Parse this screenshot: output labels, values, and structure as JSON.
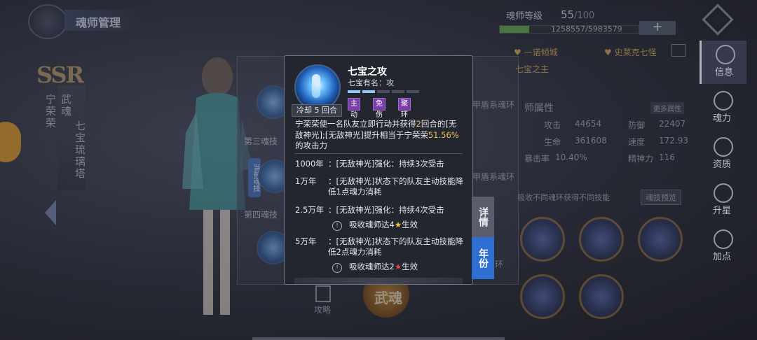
{
  "header": {
    "title": "魂师管理",
    "level_label": "魂师等级",
    "level_current": "55",
    "level_max": "/100",
    "exp_text": "1258557/5983579",
    "exp_fraction": 0.21,
    "plus": "+"
  },
  "character": {
    "rarity": "SSR",
    "name": "宁荣荣",
    "spirit_label": "武魂",
    "spirit": "七宝琉璃塔"
  },
  "skills_panel": {
    "third": "第三魂技",
    "fourth": "第四魂技",
    "current_tag": "当前魂技"
  },
  "right": {
    "bond1": "一诺倾城",
    "bond2": "史莱克七怪",
    "sub": "七宝之主",
    "ring1": "甲盾系魂环",
    "ring2": "甲盾系魂环",
    "ring3": "环",
    "attr_title": "师属性",
    "more_attr": "更多属性",
    "attack_label": "攻击",
    "attack": "44654",
    "defense_label": "防御",
    "defense": "22407",
    "hp_label": "生命",
    "hp": "361608",
    "speed_label": "速度",
    "speed": "172.93",
    "crit_label": "暴击率",
    "crit": "10.40%",
    "mind_label": "精神力",
    "mind": "116",
    "hint": "吸收不同魂环获得不同技能",
    "preview": "魂技预览"
  },
  "nav": {
    "info": "信息",
    "soul": "魂力",
    "talent": "资质",
    "star": "升星",
    "points": "加点"
  },
  "bottom": {
    "guide": "攻略",
    "emblem": "武魂"
  },
  "popup": {
    "skill_name": "七宝之攻",
    "skill_sub": "七宝有名：攻",
    "cooldown": "冷却 5 回合",
    "levels_total": 5,
    "levels_filled": 2,
    "tags": [
      "主动",
      "免伤",
      "聚环"
    ],
    "desc_a": "宁荣荣使一名队友立即行动并获得",
    "desc_num1": "2",
    "desc_b": "回合的[无敌神光];[无敌神光]提升相当于宁荣荣",
    "desc_num2": "51.56%",
    "desc_c": "的攻击力",
    "years": [
      {
        "key": "1000年",
        "value": "：[无敌神光]强化：持续3次受击"
      },
      {
        "key": "1万年",
        "value": "：[无敌神光]状态下的队友主动技能降低1点魂力消耗"
      },
      {
        "key": "2.5万年",
        "value": "：[无敌神光]强化：持续4次受击"
      },
      {
        "key": "5万年",
        "value": "：[无敌神光]状态下的队友主动技能降低2点魂力消耗"
      }
    ],
    "cond1_a": "吸收魂师达4",
    "cond1_b": "生效",
    "cond2_a": "吸收魂师达2",
    "cond2_b": "生效",
    "star": "★",
    "ex": "!"
  },
  "side_tabs": {
    "detail": "详情",
    "year": "年份"
  },
  "colors": {
    "highlight": "#f1c35a",
    "tag_bg": "#7a3ea8",
    "year_tab": "#2d6fd3",
    "star_gold": "#f3c13a",
    "star_red": "#e2413c"
  }
}
